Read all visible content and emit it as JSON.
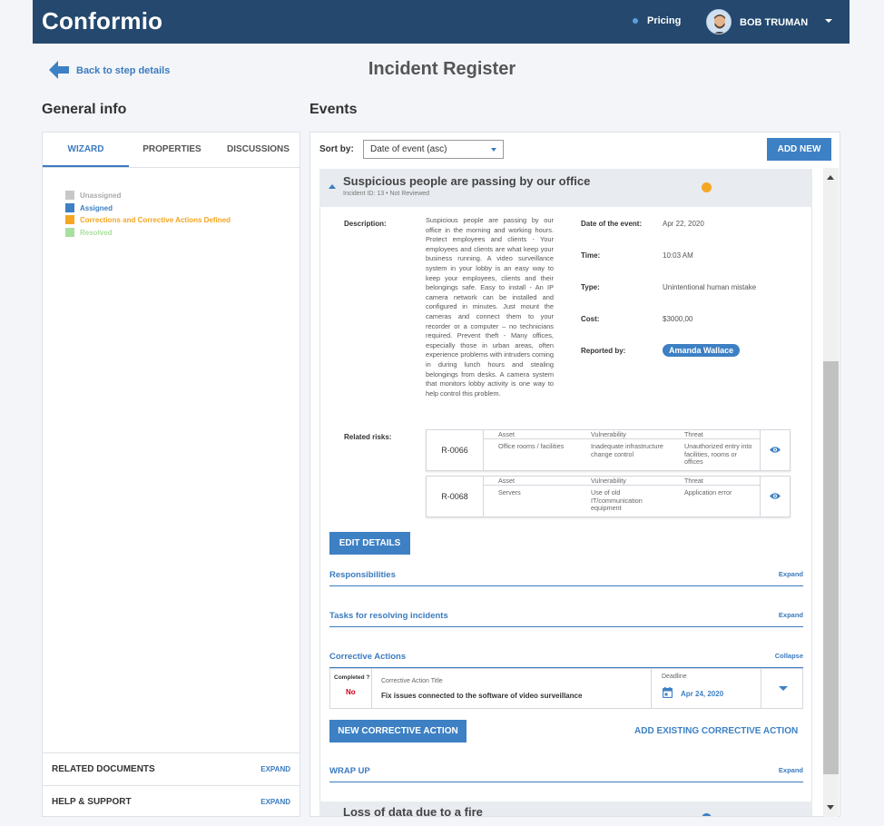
{
  "header": {
    "logo": "Conformio",
    "pricing": "Pricing",
    "user_name": "BOB TRUMAN"
  },
  "nav": {
    "back_label": "Back to step details",
    "page_title": "Incident Register"
  },
  "left": {
    "heading": "General info",
    "tabs": [
      {
        "label": "WIZARD",
        "active": true
      },
      {
        "label": "PROPERTIES",
        "active": false
      },
      {
        "label": "DISCUSSIONS",
        "active": false
      }
    ],
    "legend": [
      {
        "label": "Unassigned",
        "color": "#c8c8c8",
        "text_color": "#aaaaaa"
      },
      {
        "label": "Assigned",
        "color": "#3d80c4",
        "text_color": "#3d80c4"
      },
      {
        "label": "Corrections and Corrective Actions Defined",
        "color": "#f5a623",
        "text_color": "#f5a623"
      },
      {
        "label": "Resolved",
        "color": "#a9dfa0",
        "text_color": "#a9dfa0"
      }
    ],
    "footer": [
      {
        "label": "RELATED DOCUMENTS",
        "action": "EXPAND"
      },
      {
        "label": "HELP & SUPPORT",
        "action": "EXPAND"
      }
    ]
  },
  "right": {
    "heading": "Events",
    "sort_label": "Sort by:",
    "sort_value": "Date of event (asc)",
    "add_new": "ADD NEW"
  },
  "event": {
    "title": "Suspicious people are passing by our office",
    "subtitle": "Incident ID: 13 • Not Reviewed",
    "status_color": "#f5a623",
    "description_label": "Description:",
    "description": "Suspicious people are passing by our office in the morning and working hours. Protect employees and clients - Your employees and clients are what keep your business running. A video surveillance system in your lobby is an easy way to keep your employees, clients and their belongings safe. Easy to install - An IP camera network can be installed and configured in minutes. Just mount the cameras and connect them to your recorder or a computer – no technicians required. Prevent theft - Many offices, especially those in urban areas, often experience problems with intruders coming in during lunch hours and stealing belongings from desks. A camera system that monitors lobby activity is one way to help control this problem.",
    "fields": [
      {
        "label": "Date of the event:",
        "value": "Apr 22, 2020"
      },
      {
        "label": "Time:",
        "value": "10:03 AM"
      },
      {
        "label": "Type:",
        "value": "Unintentional human mistake"
      },
      {
        "label": "Cost:",
        "value": "$3000,00"
      }
    ],
    "reported_label": "Reported by:",
    "reported_by": "Amanda Wallace",
    "related_label": "Related risks:",
    "risk_headers": {
      "asset": "Asset",
      "vulnerability": "Vulnerability",
      "threat": "Threat"
    },
    "risks": [
      {
        "id": "R-0066",
        "asset": "Office rooms / facilities",
        "vulnerability": "Inadequate infrastructure change control",
        "threat": "Unauthorized entry into facilities, rooms or offices"
      },
      {
        "id": "R-0068",
        "asset": "Servers",
        "vulnerability": "Use of old IT/communication equipment",
        "threat": "Application error"
      }
    ],
    "edit_details": "EDIT DETAILS",
    "sections": [
      {
        "title": "Responsibilities",
        "action": "Expand"
      },
      {
        "title": "Tasks for resolving incidents",
        "action": "Expand"
      },
      {
        "title": "Corrective Actions",
        "action": "Collapse"
      }
    ],
    "corrective_action": {
      "completed_label": "Completed ?",
      "completed_value": "No",
      "title_label": "Corrective Action Title",
      "title": "Fix issues connected to the software of video surveillance",
      "deadline_label": "Deadline",
      "deadline": "Apr 24, 2020"
    },
    "new_ca": "NEW CORRECTIVE ACTION",
    "add_existing_ca": "ADD EXISTING CORRECTIVE ACTION",
    "wrap_up": {
      "title": "WRAP UP",
      "action": "Expand"
    }
  },
  "next_event": {
    "title": "Loss of data due to a fire",
    "status_color": "#3d80c4"
  }
}
